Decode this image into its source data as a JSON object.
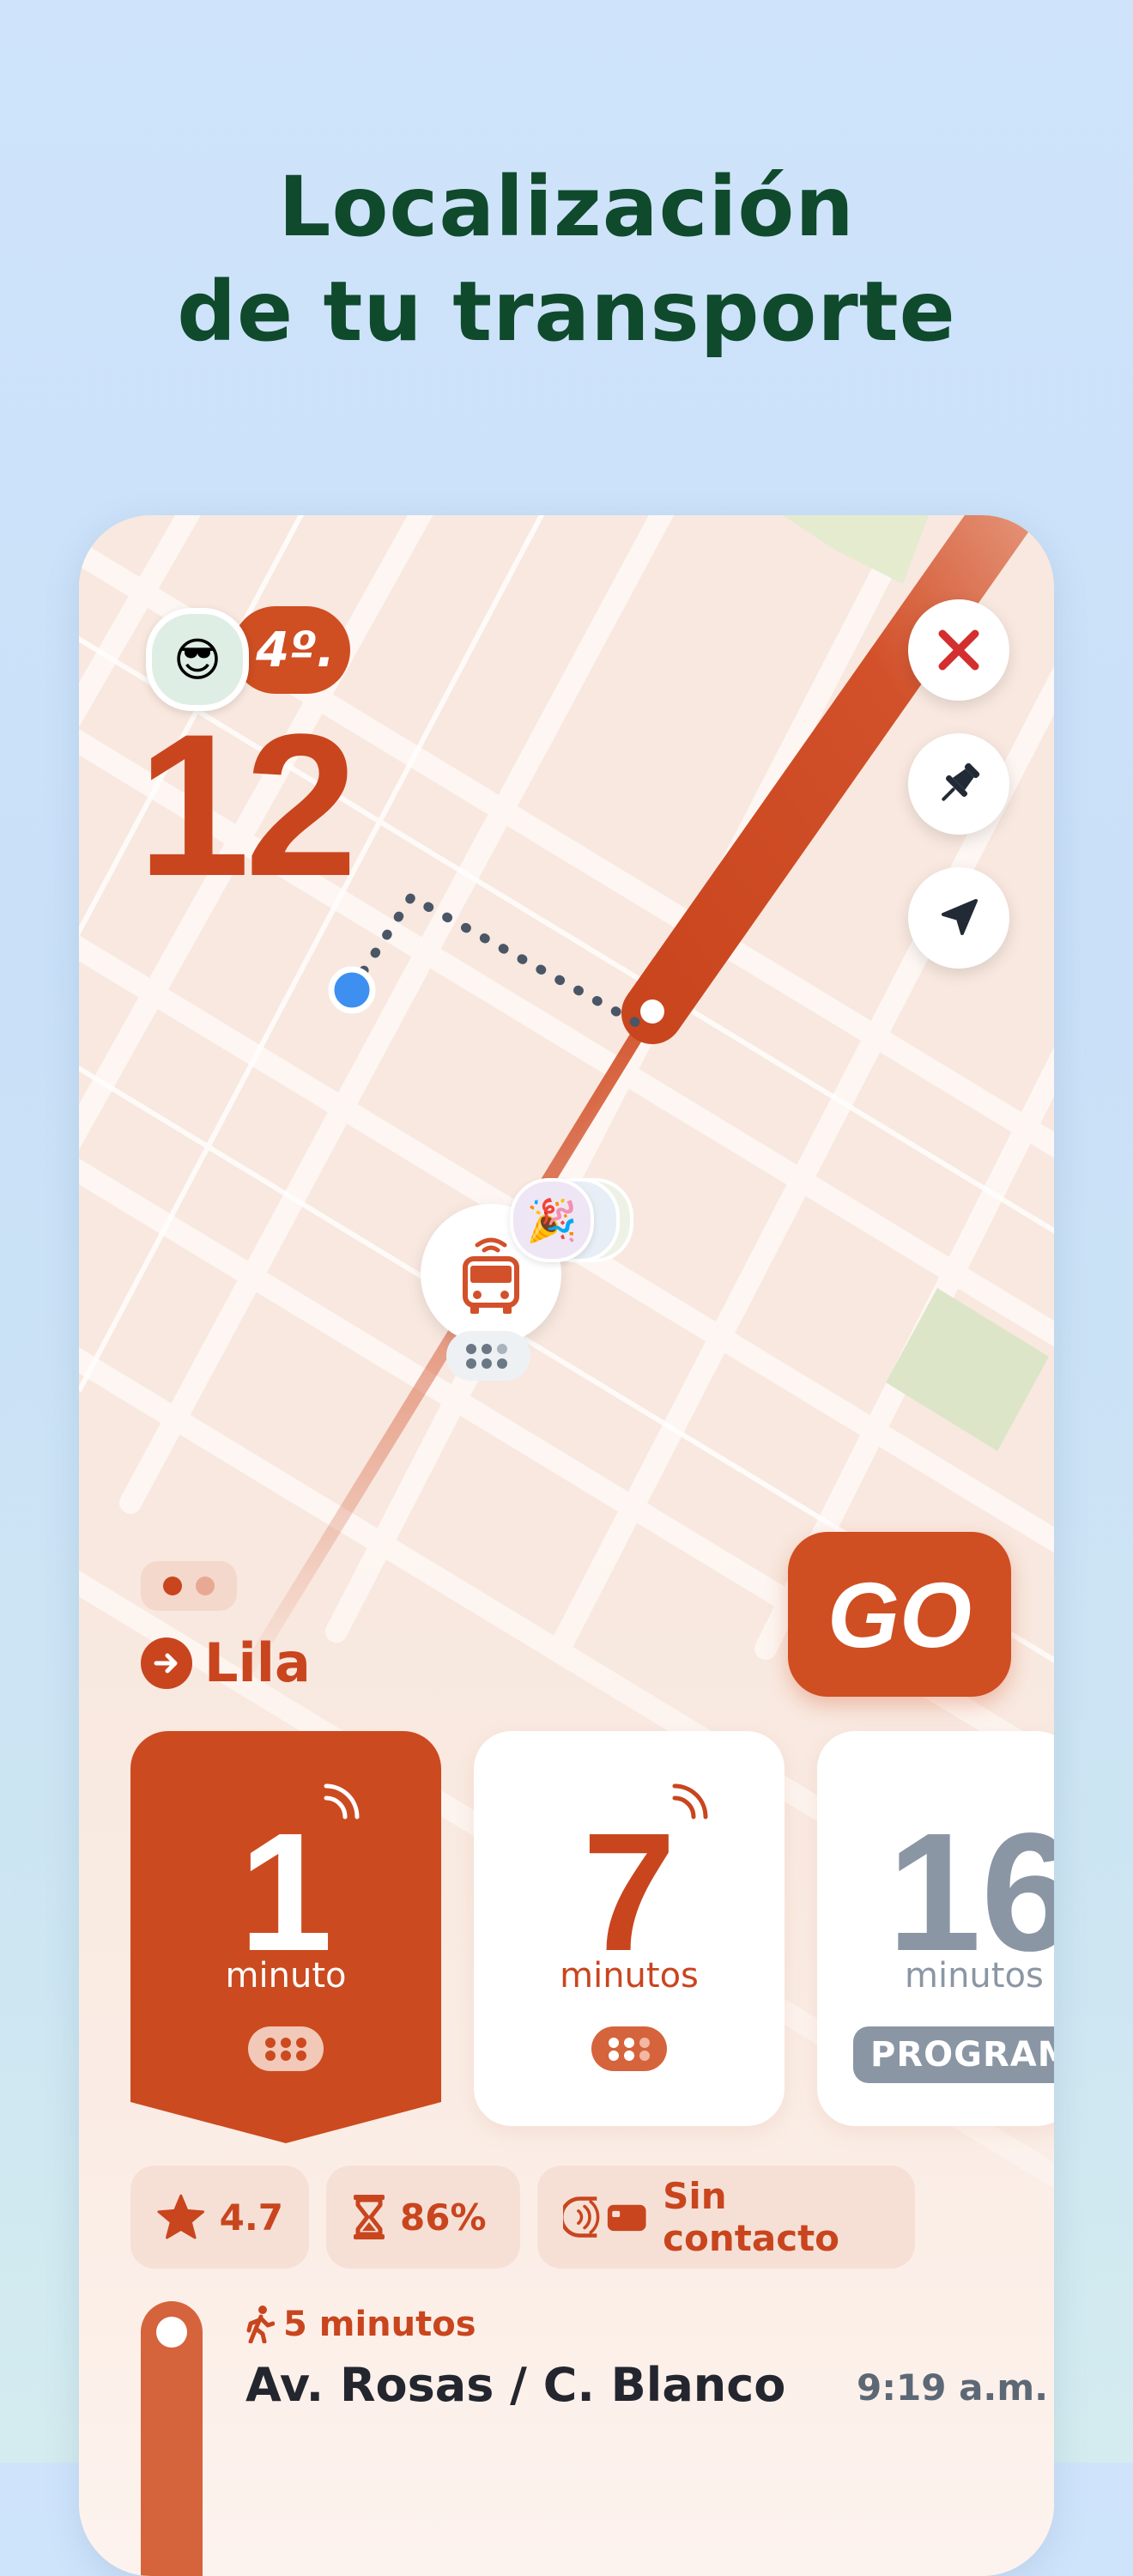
{
  "headline": {
    "line1": "Localización",
    "line2": "de tu transporte"
  },
  "map": {
    "route_color": "#d2512a",
    "rank_label": "4º.",
    "avatar_emoji": "😎",
    "line_number": "12",
    "icons": {
      "close": "close-icon",
      "pin": "pushpin-icon",
      "locate": "navigation-arrow-icon",
      "bus": "bus-icon",
      "reaction": "party-popper-icon"
    },
    "reaction_emoji": "🎉"
  },
  "destination": {
    "label": "Lila"
  },
  "go_button": {
    "label": "GO"
  },
  "arrivals": [
    {
      "value": "1",
      "unit": "minuto"
    },
    {
      "value": "7",
      "unit": "minutos"
    },
    {
      "value": "16",
      "unit": "minutos",
      "badge": "PROGRAMADO"
    }
  ],
  "chips": {
    "rating": "4.7",
    "occupancy": "86%",
    "payment": "Sin contacto"
  },
  "stop": {
    "walk": "5 minutos",
    "name": "Av. Rosas / C. Blanco",
    "time": "9:19 a.m."
  },
  "colors": {
    "accent": "#cc4a1f",
    "headline": "#0f4a2c",
    "grey": "#8a96a4",
    "blue_dot": "#3d8ff0"
  }
}
